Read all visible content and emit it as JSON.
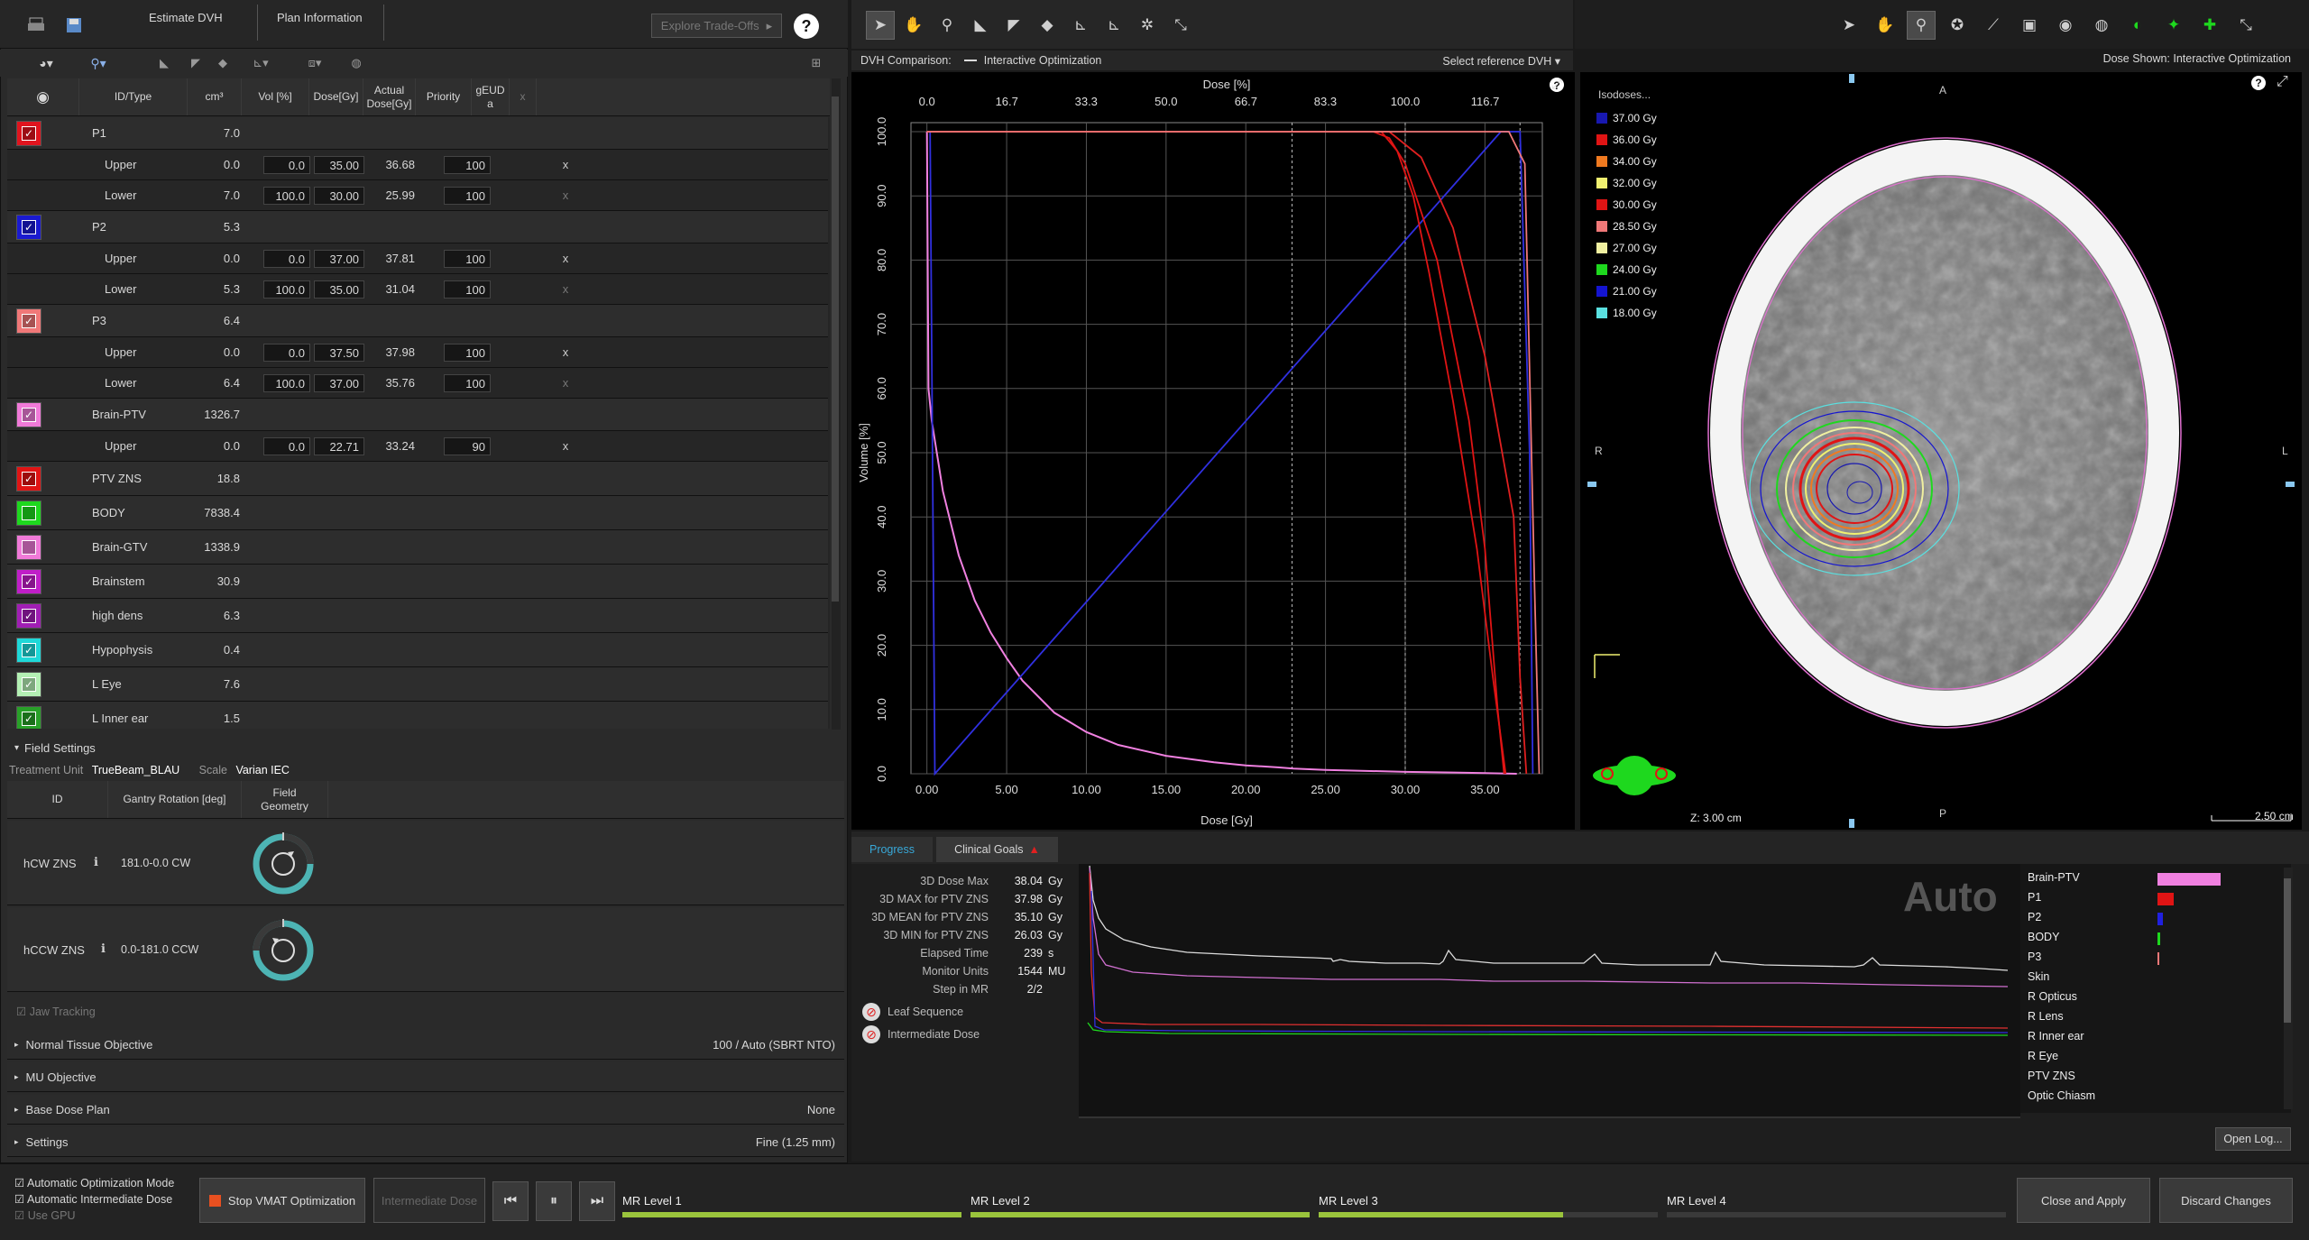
{
  "header": {
    "tabs": [
      "Estimate DVH",
      "Plan Information"
    ],
    "explore_button": "Explore Trade-Offs",
    "help": "?"
  },
  "table": {
    "columns": [
      "ID/Type",
      "cm³",
      "Vol [%]",
      "Dose[Gy]",
      "Actual Dose[Gy]",
      "Priority",
      "gEUD a",
      "x"
    ],
    "rows": [
      {
        "type": "structure",
        "id": "P1",
        "cm3": "7.0",
        "color": "#e0141e",
        "checked": true
      },
      {
        "type": "objective",
        "id": "Upper",
        "cm3": "0.0",
        "vol": "0.0",
        "dose": "35.00",
        "actual": "36.68",
        "priority": "100",
        "x": "x"
      },
      {
        "type": "objective",
        "id": "Lower",
        "cm3": "7.0",
        "vol": "100.0",
        "dose": "30.00",
        "actual": "25.99",
        "priority": "100",
        "x": "x"
      },
      {
        "type": "structure",
        "id": "P2",
        "cm3": "5.3",
        "color": "#1a1ad0",
        "checked": true
      },
      {
        "type": "objective",
        "id": "Upper",
        "cm3": "0.0",
        "vol": "0.0",
        "dose": "37.00",
        "actual": "37.81",
        "priority": "100",
        "x": "x"
      },
      {
        "type": "objective",
        "id": "Lower",
        "cm3": "5.3",
        "vol": "100.0",
        "dose": "35.00",
        "actual": "31.04",
        "priority": "100",
        "x": "x"
      },
      {
        "type": "structure",
        "id": "P3",
        "cm3": "6.4",
        "color": "#f07878",
        "checked": true
      },
      {
        "type": "objective",
        "id": "Upper",
        "cm3": "0.0",
        "vol": "0.0",
        "dose": "37.50",
        "actual": "37.98",
        "priority": "100",
        "x": "x"
      },
      {
        "type": "objective",
        "id": "Lower",
        "cm3": "6.4",
        "vol": "100.0",
        "dose": "37.00",
        "actual": "35.76",
        "priority": "100",
        "x": "x"
      },
      {
        "type": "structure",
        "id": "Brain-PTV",
        "cm3": "1326.7",
        "color": "#f07ad8",
        "checked": true
      },
      {
        "type": "objective",
        "id": "Upper",
        "cm3": "0.0",
        "vol": "0.0",
        "dose": "22.71",
        "actual": "33.24",
        "priority": "90",
        "x": "x"
      },
      {
        "type": "structure",
        "id": "PTV ZNS",
        "cm3": "18.8",
        "color": "#e01414",
        "checked": true
      },
      {
        "type": "structure",
        "id": "BODY",
        "cm3": "7838.4",
        "color": "#1ed81e",
        "checked": false
      },
      {
        "type": "structure",
        "id": "Brain-GTV",
        "cm3": "1338.9",
        "color": "#f07ad8",
        "checked": false
      },
      {
        "type": "structure",
        "id": "Brainstem",
        "cm3": "30.9",
        "color": "#c01ec8",
        "checked": true
      },
      {
        "type": "structure",
        "id": "high dens",
        "cm3": "6.3",
        "color": "#a01eb4",
        "checked": true
      },
      {
        "type": "structure",
        "id": "Hypophysis",
        "cm3": "0.4",
        "color": "#1ed8d8",
        "checked": true
      },
      {
        "type": "structure",
        "id": "L Eye",
        "cm3": "7.6",
        "color": "#b4f0b4",
        "checked": true
      },
      {
        "type": "structure",
        "id": "L Inner ear",
        "cm3": "1.5",
        "color": "#28a028",
        "checked": true
      }
    ]
  },
  "field_settings": {
    "title": "Field Settings",
    "treatment_unit_label": "Treatment Unit",
    "treatment_unit": "TrueBeam_BLAU",
    "scale_label": "Scale",
    "scale": "Varian IEC",
    "columns": [
      "ID",
      "Gantry Rotation [deg]",
      "Field Geometry"
    ],
    "fields": [
      {
        "id": "hCW ZNS",
        "rotation": "181.0-0.0 CW"
      },
      {
        "id": "hCCW ZNS",
        "rotation": "0.0-181.0 CCW"
      }
    ],
    "jaw_tracking": "Jaw Tracking"
  },
  "sections": [
    {
      "label": "Normal Tissue Objective",
      "value": "100 / Auto (SBRT NTO)"
    },
    {
      "label": "MU Objective",
      "value": ""
    },
    {
      "label": "Base Dose Plan",
      "value": "None"
    },
    {
      "label": "Settings",
      "value": "Fine (1.25 mm)"
    }
  ],
  "bottom": {
    "auto_mode": "Automatic Optimization Mode",
    "auto_intermediate": "Automatic Intermediate Dose",
    "use_gpu": "Use GPU",
    "stop_button": "Stop VMAT Optimization",
    "intermediate_button": "Intermediate Dose",
    "mr_levels": [
      {
        "label": "MR Level 1",
        "progress": 1.0
      },
      {
        "label": "MR Level 2",
        "progress": 1.0
      },
      {
        "label": "MR Level 3",
        "progress": 0.72
      },
      {
        "label": "MR Level 4",
        "progress": 0.0
      }
    ],
    "close_apply": "Close and Apply",
    "discard": "Discard Changes"
  },
  "dvh": {
    "comparison_label": "DVH Comparison:",
    "comparison_value": "Interactive Optimization",
    "select_reference": "Select reference DVH",
    "top_axis_title": "Dose [%]",
    "top_ticks": [
      "0.0",
      "16.7",
      "33.3",
      "50.0",
      "66.7",
      "83.3",
      "100.0",
      "116.7"
    ],
    "x_ticks": [
      "0.00",
      "5.00",
      "10.00",
      "15.00",
      "20.00",
      "25.00",
      "30.00",
      "35.00"
    ],
    "x_title": "Dose [Gy]",
    "y_ticks": [
      "0.0",
      "10.0",
      "20.0",
      "30.0",
      "40.0",
      "50.0",
      "60.0",
      "70.0",
      "80.0",
      "90.0",
      "100.0"
    ],
    "y_title": "Volume [%]"
  },
  "chart_data": {
    "type": "line",
    "title": "",
    "xlabel": "Dose [Gy]",
    "ylabel": "Volume [%]",
    "xlim": [
      -1,
      38.6
    ],
    "ylim": [
      0,
      100
    ],
    "grid": true,
    "series": [
      {
        "color": "#f080e0",
        "x": [
          0,
          0.1,
          0.3,
          1,
          2,
          3,
          4,
          5,
          6,
          8,
          10,
          12,
          15,
          18,
          20,
          22,
          23,
          25,
          30,
          33,
          35,
          37
        ],
        "y": [
          100,
          60,
          55,
          44,
          34,
          27,
          22,
          18,
          14.5,
          9.5,
          6.5,
          4.5,
          2.8,
          1.8,
          1.3,
          1.0,
          0.8,
          0.6,
          0.3,
          0.2,
          0.1,
          0
        ]
      },
      {
        "color": "#3030e0",
        "x": [
          0,
          0.2,
          0.5,
          36,
          37.2,
          37.8,
          38.0
        ],
        "y": [
          100,
          100,
          0,
          100,
          100,
          50,
          0
        ]
      },
      {
        "color": "#e01414",
        "x": [
          0,
          28,
          29,
          30,
          32,
          34,
          35,
          35.8,
          36.2
        ],
        "y": [
          100,
          100,
          99,
          95,
          80,
          55,
          35,
          10,
          0
        ]
      },
      {
        "color": "#e01414",
        "x": [
          0,
          28.5,
          29.5,
          30.5,
          31.5,
          33,
          34.5,
          35.5,
          36.3
        ],
        "y": [
          100,
          100,
          97,
          90,
          78,
          58,
          35,
          15,
          0
        ]
      },
      {
        "color": "#e02020",
        "x": [
          0,
          29,
          31,
          33,
          35,
          36.8,
          37.2,
          37.6
        ],
        "y": [
          100,
          100,
          96,
          85,
          65,
          40,
          15,
          0
        ]
      },
      {
        "color": "#f07878",
        "x": [
          0,
          36.5,
          37.5,
          38.1,
          38.4
        ],
        "y": [
          100,
          100,
          95,
          30,
          0
        ]
      }
    ]
  },
  "image_view": {
    "dose_shown": "Dose Shown: Interactive Optimization",
    "isodose_title": "Isodoses...",
    "isodoses": [
      {
        "label": "37.00 Gy",
        "color": "#1818b0"
      },
      {
        "label": "36.00 Gy",
        "color": "#e01414"
      },
      {
        "label": "34.00 Gy",
        "color": "#f07a20"
      },
      {
        "label": "32.00 Gy",
        "color": "#f0f070"
      },
      {
        "label": "30.00 Gy",
        "color": "#e01414"
      },
      {
        "label": "28.50 Gy",
        "color": "#f07878"
      },
      {
        "label": "27.00 Gy",
        "color": "#f0f0a0"
      },
      {
        "label": "24.00 Gy",
        "color": "#1ed81e"
      },
      {
        "label": "21.00 Gy",
        "color": "#1414d0"
      },
      {
        "label": "18.00 Gy",
        "color": "#5ae0e0"
      }
    ],
    "orient_a": "A",
    "orient_p": "P",
    "orient_r": "R",
    "orient_l": "L",
    "z_label": "Z: 3.00 cm",
    "scale_label": "2.50 cm"
  },
  "progress": {
    "tabs": [
      "Progress",
      "Clinical Goals"
    ],
    "stats": [
      {
        "label": "3D Dose Max",
        "value": "38.04",
        "unit": "Gy"
      },
      {
        "label": "3D MAX for PTV ZNS",
        "value": "37.98",
        "unit": "Gy"
      },
      {
        "label": "3D MEAN for PTV ZNS",
        "value": "35.10",
        "unit": "Gy"
      },
      {
        "label": "3D MIN for PTV ZNS",
        "value": "26.03",
        "unit": "Gy"
      },
      {
        "label": "Elapsed Time",
        "value": "239",
        "unit": "s"
      },
      {
        "label": "Monitor Units",
        "value": "1544",
        "unit": "MU"
      },
      {
        "label": "Step in MR",
        "value": "2/2",
        "unit": ""
      }
    ],
    "leaf_sequence": "Leaf Sequence",
    "intermediate_dose": "Intermediate Dose",
    "auto_label": "Auto",
    "open_log": "Open Log...",
    "legend": [
      {
        "name": "Brain-PTV",
        "color": "#f080e0",
        "bar": 1.0
      },
      {
        "name": "P1",
        "color": "#e01414",
        "bar": 0.25
      },
      {
        "name": "P2",
        "color": "#2020e0",
        "bar": 0.08
      },
      {
        "name": "BODY",
        "color": "#1ed81e",
        "bar": 0.04
      },
      {
        "name": "P3",
        "color": "#f07878",
        "bar": 0.02
      },
      {
        "name": "Skin",
        "color": "",
        "bar": 0
      },
      {
        "name": "R Opticus",
        "color": "",
        "bar": 0
      },
      {
        "name": "R Lens",
        "color": "",
        "bar": 0
      },
      {
        "name": "R Inner ear",
        "color": "",
        "bar": 0
      },
      {
        "name": "R Eye",
        "color": "",
        "bar": 0
      },
      {
        "name": "PTV ZNS",
        "color": "",
        "bar": 0
      },
      {
        "name": "Optic Chiasm",
        "color": "",
        "bar": 0
      }
    ]
  }
}
